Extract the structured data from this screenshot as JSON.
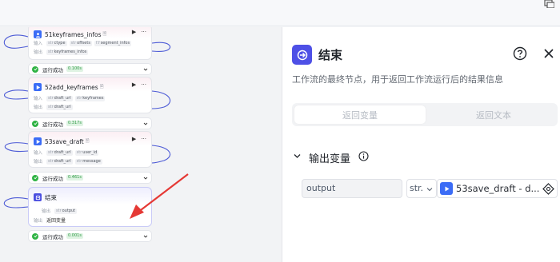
{
  "canvas": {
    "nodes": [
      {
        "title": "51keyframes_infos",
        "rows": [
          {
            "label": "输入",
            "chips": [
              {
                "type": "str",
                "text": "ctype"
              },
              {
                "type": "str",
                "text": "offsets"
              },
              {
                "type": "f.f",
                "text": "segment_infos"
              }
            ]
          },
          {
            "label": "输出",
            "chips": [
              {
                "type": "str",
                "text": "keyframes_infos"
              }
            ]
          }
        ],
        "status": "运行成功",
        "time": "0.100s"
      },
      {
        "title": "52add_keyframes",
        "rows": [
          {
            "label": "输入",
            "chips": [
              {
                "type": "str",
                "text": "draft_url"
              },
              {
                "type": "str",
                "text": "keyframes"
              }
            ]
          },
          {
            "label": "输出",
            "chips": [
              {
                "type": "str",
                "text": "draft_url"
              }
            ]
          }
        ],
        "status": "运行成功",
        "time": "0.317s"
      },
      {
        "title": "53save_draft",
        "rows": [
          {
            "label": "输入",
            "chips": [
              {
                "type": "str",
                "text": "draft_url"
              },
              {
                "type": "str",
                "text": "user_id"
              }
            ]
          },
          {
            "label": "输出",
            "chips": [
              {
                "type": "str",
                "text": "draft_url"
              },
              {
                "type": "str",
                "text": "message"
              }
            ]
          }
        ],
        "status": "运行成功",
        "time": "0.461s"
      },
      {
        "title": "结束",
        "rows": [
          {
            "label": "输出",
            "chips": [
              {
                "type": "str",
                "text": "output"
              }
            ]
          },
          {
            "label": "输出",
            "plain": "返回变量"
          }
        ],
        "status": "运行成功",
        "time": "0.001s"
      }
    ]
  },
  "panel": {
    "title": "结束",
    "description": "工作流的最终节点，用于返回工作流运行后的结果信息",
    "tabs": [
      "返回变量",
      "返回文本"
    ],
    "section_title": "输出变量",
    "output": {
      "name": "output",
      "type": "str.",
      "ref": "53save_draft - d..."
    }
  },
  "colors": {
    "accent": "#4e50e6",
    "plugin": "#3b6cf6",
    "success": "#2fb344",
    "arrow": "#e53935"
  }
}
